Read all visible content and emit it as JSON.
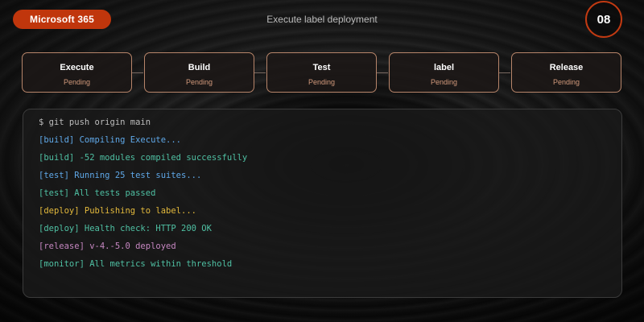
{
  "header": {
    "brand": "Microsoft 365",
    "title": "Execute label deployment",
    "step": "08"
  },
  "pipeline": {
    "stages": [
      {
        "name": "Execute",
        "status": "Pending"
      },
      {
        "name": "Build",
        "status": "Pending"
      },
      {
        "name": "Test",
        "status": "Pending"
      },
      {
        "name": "label",
        "status": "Pending"
      },
      {
        "name": "Release",
        "status": "Pending"
      }
    ]
  },
  "terminal": {
    "lines": [
      {
        "text": "$ git push origin main",
        "color": "#bdbdbd"
      },
      {
        "text": "[build] Compiling Execute...",
        "color": "#5fa8e8"
      },
      {
        "text": "[build] -52 modules compiled successfully",
        "color": "#4fc0a3"
      },
      {
        "text": "[test] Running 25 test suites...",
        "color": "#5fa8e8"
      },
      {
        "text": "[test] All tests passed",
        "color": "#4fc0a3"
      },
      {
        "text": "[deploy] Publishing to label...",
        "color": "#e3b93c"
      },
      {
        "text": "[deploy] Health check: HTTP 200 OK",
        "color": "#4fc0a3"
      },
      {
        "text": "[release] v-4.-5.0 deployed",
        "color": "#c586c0"
      },
      {
        "text": "[monitor] All metrics within threshold",
        "color": "#4fc0a3"
      }
    ]
  },
  "colors": {
    "accent": "#c0360c",
    "stage_border": "#b7856a",
    "stage_status": "#d39a7c"
  }
}
